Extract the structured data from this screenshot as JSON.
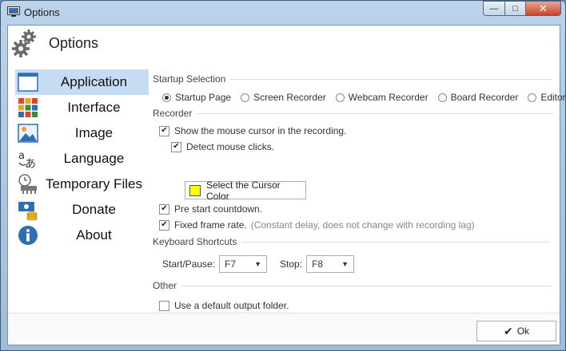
{
  "window": {
    "title": "Options",
    "minimize_glyph": "—",
    "maximize_glyph": "□",
    "close_glyph": "✕"
  },
  "header": {
    "title": "Options",
    "icon": "gears-icon"
  },
  "sidebar": {
    "items": [
      {
        "label": "Application",
        "icon": "application-window-icon",
        "selected": true
      },
      {
        "label": "Interface",
        "icon": "tiles-icon",
        "selected": false
      },
      {
        "label": "Image",
        "icon": "picture-icon",
        "selected": false
      },
      {
        "label": "Language",
        "icon": "language-icon",
        "selected": false
      },
      {
        "label": "Temporary Files",
        "icon": "clock-disk-icon",
        "selected": false
      },
      {
        "label": "Donate",
        "icon": "money-icon",
        "selected": false
      },
      {
        "label": "About",
        "icon": "info-icon",
        "selected": false
      }
    ]
  },
  "startup": {
    "title": "Startup Selection",
    "options": [
      "Startup Page",
      "Screen Recorder",
      "Webcam Recorder",
      "Board Recorder",
      "Editor"
    ],
    "selected": "Startup Page"
  },
  "recorder": {
    "title": "Recorder",
    "show_cursor": {
      "label": "Show the mouse cursor in the recording.",
      "checked": true
    },
    "detect_clicks": {
      "label": "Detect mouse clicks.",
      "checked": true
    },
    "cursor_color": {
      "label": "Select the Cursor Color",
      "color": "#ffff00"
    },
    "countdown": {
      "label": "Pre start countdown.",
      "checked": true
    },
    "fixed_rate": {
      "label": "Fixed frame rate.",
      "hint": "(Constant delay, does not change with recording lag)",
      "checked": true
    }
  },
  "shortcuts": {
    "title": "Keyboard Shortcuts",
    "start_pause_label": "Start/Pause:",
    "start_pause_value": "F7",
    "stop_label": "Stop:",
    "stop_value": "F8"
  },
  "other": {
    "title": "Other",
    "default_folder": {
      "label": "Use a default output folder.",
      "checked": false
    }
  },
  "footer": {
    "ok_label": "Ok",
    "check_glyph": "✔"
  },
  "colors": {
    "selection": "#c5dcf4",
    "accent": "#2c6fb5"
  }
}
